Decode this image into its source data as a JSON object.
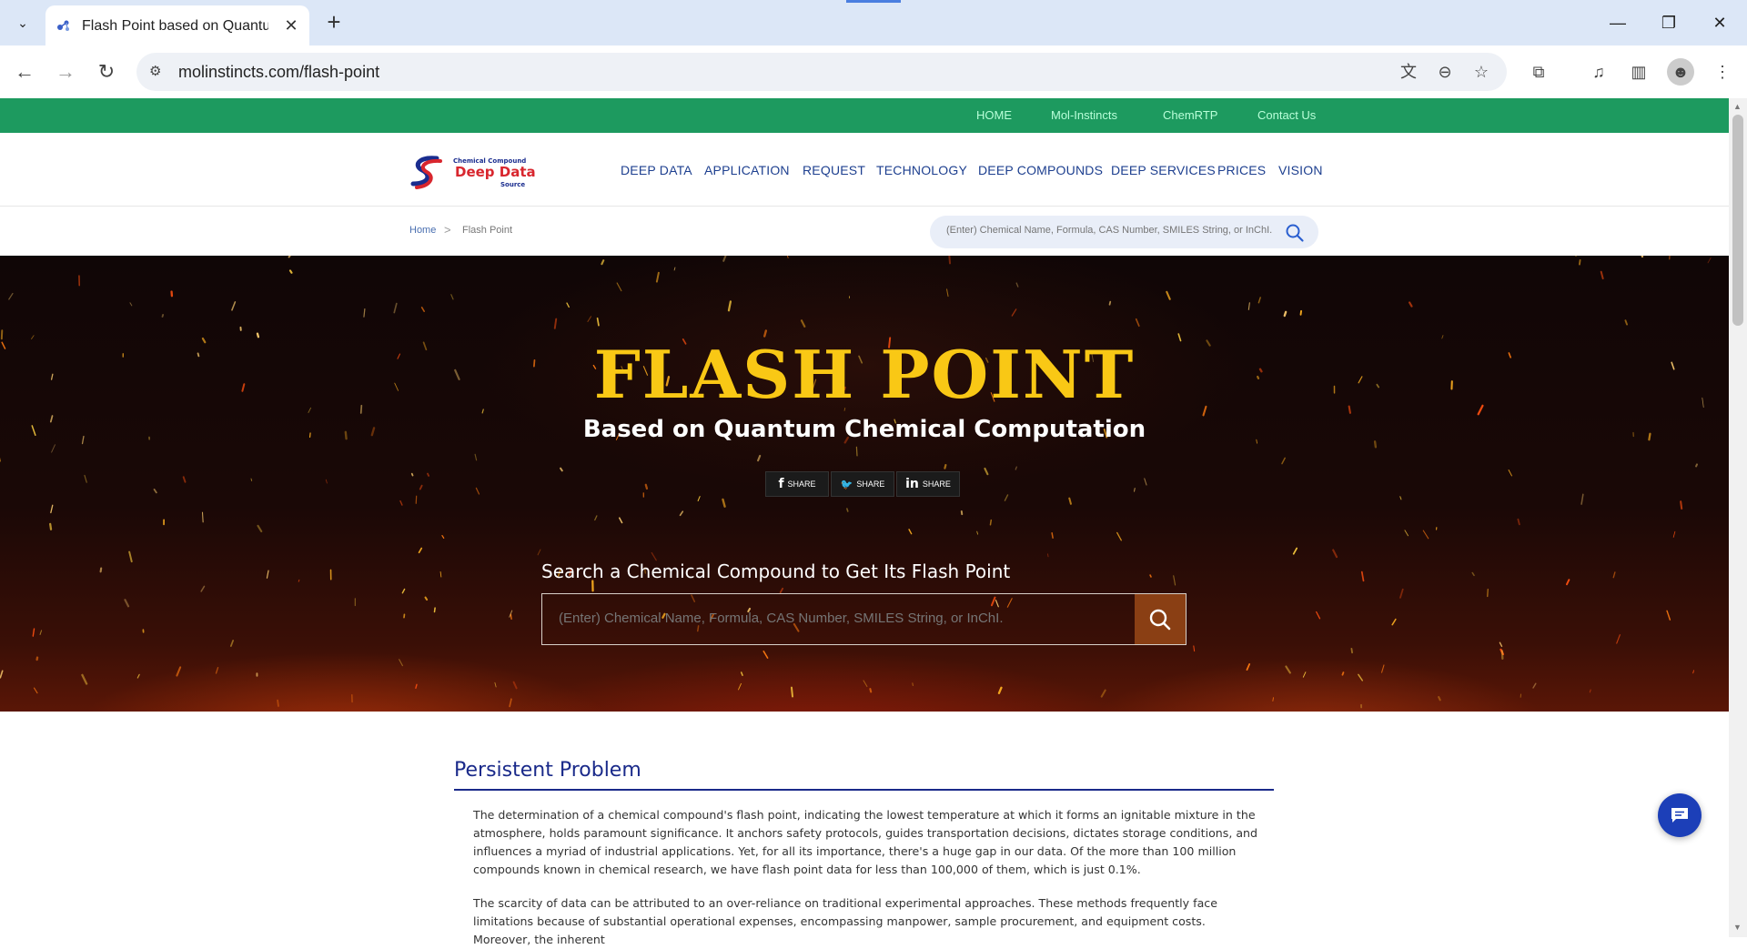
{
  "browser": {
    "tab_title": "Flash Point based on Quantum Chemical Computation",
    "new_tab_label": "+",
    "url": "molinstincts.com/flash-point",
    "window_controls": [
      "minimize-icon",
      "restore-icon",
      "close-icon"
    ]
  },
  "topbar": {
    "links": [
      "HOME",
      "Mol-Instincts",
      "ChemRTP",
      "Contact Us"
    ]
  },
  "logo": {
    "line1": "Chemical Compound",
    "line2": "Deep Data",
    "line3": "Source"
  },
  "nav": {
    "items": [
      "DEEP DATA",
      "APPLICATION",
      "REQUEST",
      "TECHNOLOGY",
      "DEEP COMPOUNDS",
      "DEEP SERVICES",
      "PRICES",
      "VISION"
    ]
  },
  "breadcrumb": {
    "home": "Home",
    "separator": ">",
    "current": "Flash Point"
  },
  "header_search": {
    "placeholder": "(Enter) Chemical Name, Formula, CAS Number, SMILES String, or InChI."
  },
  "hero": {
    "title": "FLASH POINT",
    "subtitle": "Based on Quantum Chemical Computation",
    "share_buttons": [
      {
        "icon": "facebook-icon",
        "glyph": "f",
        "label": "SHARE"
      },
      {
        "icon": "twitter-icon",
        "glyph": "🐦",
        "label": "SHARE"
      },
      {
        "icon": "linkedin-icon",
        "glyph": "in",
        "label": "SHARE"
      }
    ],
    "search_label": "Search a Chemical Compound to Get Its Flash Point",
    "search_placeholder": "(Enter) Chemical Name, Formula, CAS Number, SMILES String, or InChI."
  },
  "content": {
    "section_title": "Persistent Problem",
    "paragraphs": [
      "The determination of a chemical compound's flash point, indicating the lowest temperature at which it forms an ignitable mixture in the atmosphere, holds paramount significance. It anchors safety protocols, guides transportation decisions, dictates storage conditions, and influences a myriad of industrial applications. Yet, for all its importance, there's a huge gap in our data. Of the more than 100 million compounds known in chemical research, we have flash point data for less than 100,000 of them, which is just 0.1%.",
      "The scarcity of data can be attributed to an over-reliance on traditional experimental approaches. These methods frequently face limitations because of substantial operational expenses, encompassing manpower, sample procurement, and equipment costs. Moreover, the inherent"
    ]
  },
  "colors": {
    "topbar": "#1d9a5f",
    "nav_text": "#1d3f8f",
    "hero_title": "#f9c815",
    "section_title": "#1a2a8a",
    "search_button": "#8a3f14",
    "chat_button": "#1c3fb8"
  }
}
